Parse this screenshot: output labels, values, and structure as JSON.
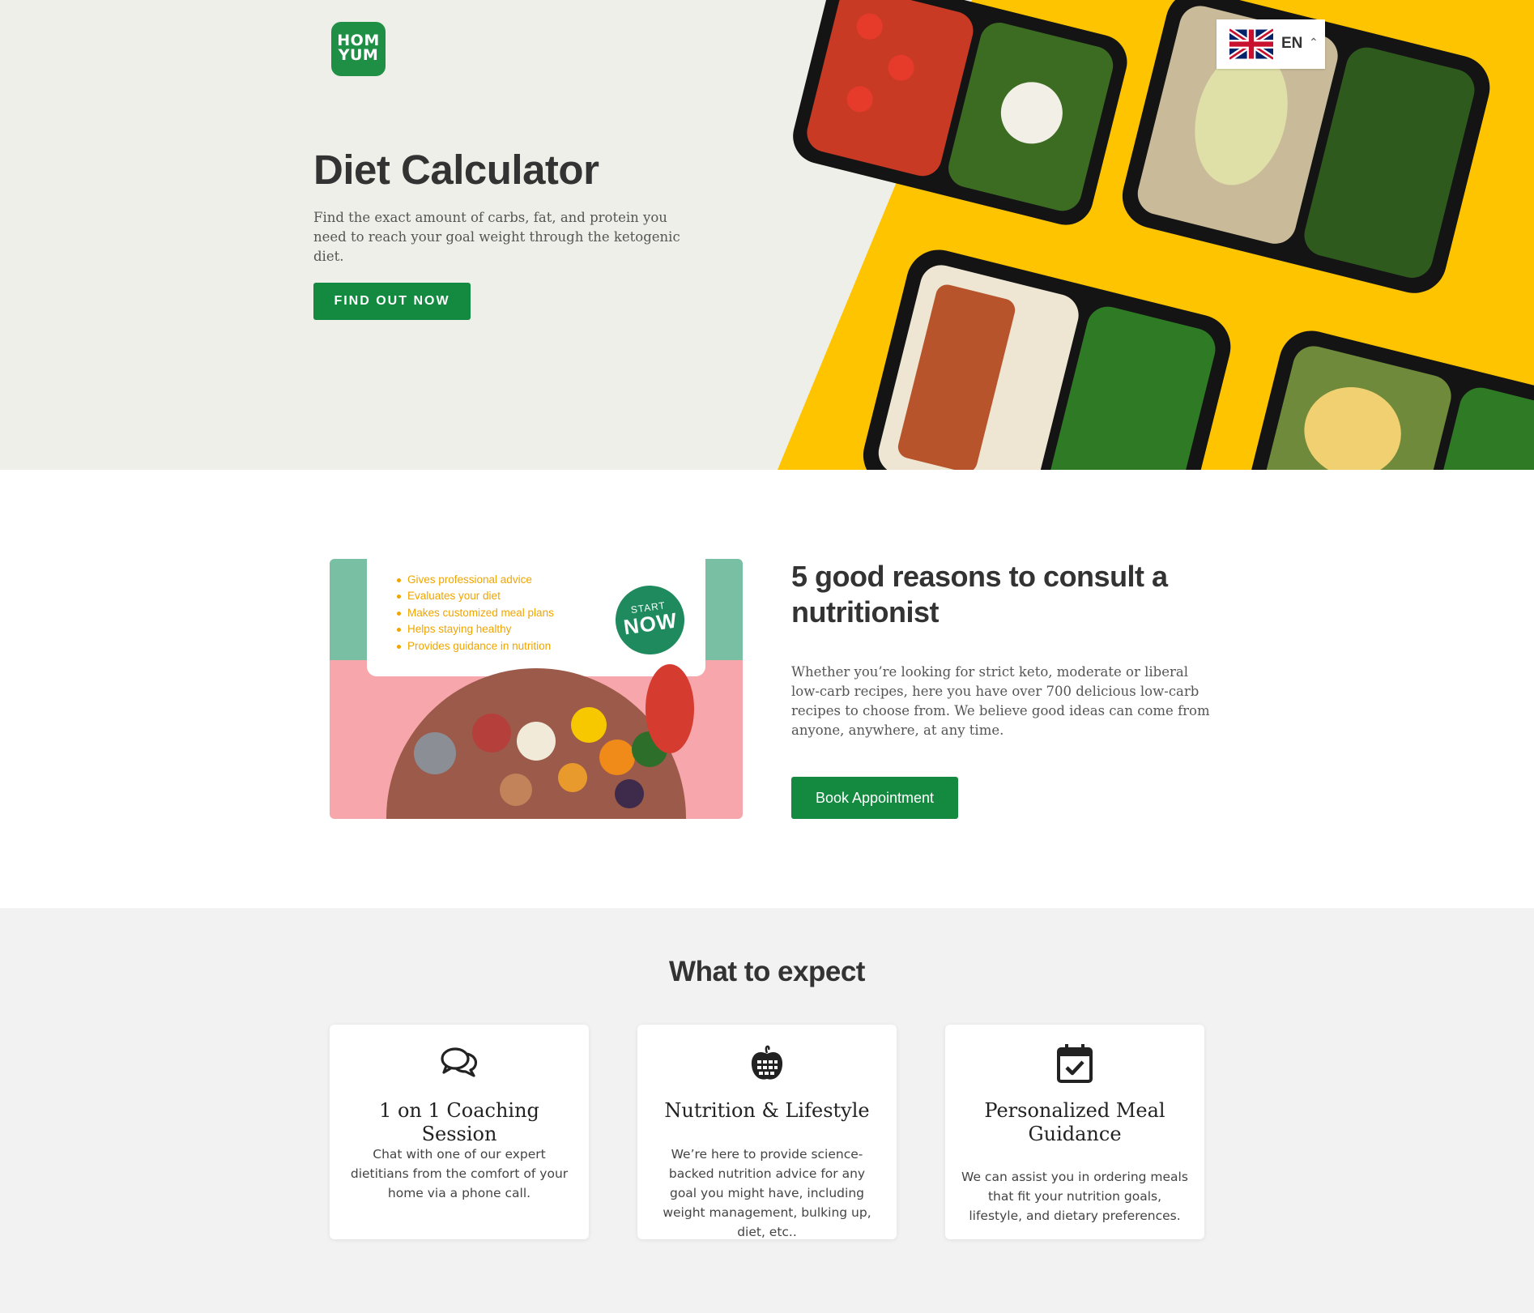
{
  "brand": {
    "logo_line1": "HOM",
    "logo_line2": "YUM",
    "primary_color": "#138a3f",
    "accent_color": "#ffc400"
  },
  "language": {
    "code": "EN",
    "flag_icon": "uk-flag-icon"
  },
  "hero": {
    "title": "Diet Calculator",
    "subtitle": "Find the exact amount of carbs, fat, and protein you need to reach your goal weight through the ketogenic diet.",
    "cta": "FIND OUT NOW"
  },
  "reasons": {
    "title": "5 good reasons to consult a nutritionist",
    "text": "Whether you’re looking for strict keto, moderate or liberal low-carb recipes, here you have over 700 delicious low-carb recipes to choose from. We believe good ideas can come from anyone, anywhere, at any time.",
    "cta": "Book Appointment",
    "image": {
      "list": [
        "Gives professional advice",
        "Evaluates your diet",
        "Makes customized meal plans",
        "Helps staying healthy",
        "Provides guidance in nutrition"
      ],
      "badge_small": "START",
      "badge_big": "NOW"
    }
  },
  "expect": {
    "title": "What to expect",
    "cards": [
      {
        "icon": "chat-bubbles-icon",
        "title": "1 on 1 Coaching Session",
        "text": "Chat with one of our expert dietitians from the comfort of your home via a phone call."
      },
      {
        "icon": "apple-calendar-icon",
        "title": "Nutrition & Lifestyle",
        "text": "We’re here to provide science-backed nutrition advice for any goal you might have, including weight management, bulking up, diet, etc.."
      },
      {
        "icon": "calendar-check-icon",
        "title": "Personalized Meal Guidance",
        "text": "We can assist you in ordering meals that fit your nutrition goals, lifestyle, and dietary preferences."
      }
    ]
  }
}
